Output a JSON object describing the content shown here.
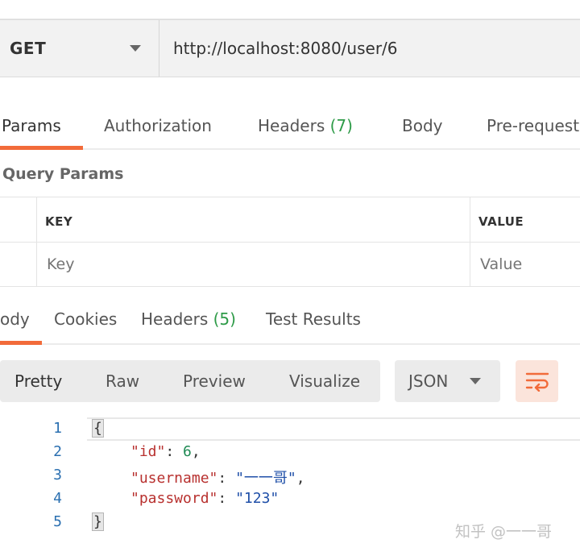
{
  "request": {
    "method": "GET",
    "url": "http://localhost:8080/user/6"
  },
  "request_tabs": [
    {
      "label": "Params",
      "count": ""
    },
    {
      "label": "Authorization",
      "count": ""
    },
    {
      "label": "Headers",
      "count": "(7)"
    },
    {
      "label": "Body",
      "count": ""
    },
    {
      "label": "Pre-request",
      "count": ""
    }
  ],
  "query_params": {
    "title": "Query Params",
    "columns": [
      "KEY",
      "VALUE"
    ],
    "key_placeholder": "Key",
    "value_placeholder": "Value"
  },
  "response_tabs": [
    {
      "label": "ody",
      "count": ""
    },
    {
      "label": "Cookies",
      "count": ""
    },
    {
      "label": "Headers",
      "count": "(5)"
    },
    {
      "label": "Test Results",
      "count": ""
    }
  ],
  "view_modes": [
    "Pretty",
    "Raw",
    "Preview",
    "Visualize"
  ],
  "format": "JSON",
  "wrap_icon": "wrap-lines-icon",
  "code": {
    "line_numbers": [
      "1",
      "2",
      "3",
      "4",
      "5"
    ],
    "open_brace": "{",
    "close_brace": "}",
    "lines": [
      {
        "key": "\"id\"",
        "sep": ": ",
        "value": "6",
        "value_type": "number",
        "tail": ","
      },
      {
        "key": "\"username\"",
        "sep": ": ",
        "value": "\"一一哥\"",
        "value_type": "string",
        "tail": ","
      },
      {
        "key": "\"password\"",
        "sep": ": ",
        "value": "\"123\"",
        "value_type": "string",
        "tail": ""
      }
    ]
  },
  "watermark": "知乎 @一一哥",
  "colors": {
    "accent": "#f26b3a",
    "count_green": "#2e9b48",
    "json_key": "#b8312f",
    "json_number": "#1f8a54",
    "json_string": "#1f4fa8"
  }
}
